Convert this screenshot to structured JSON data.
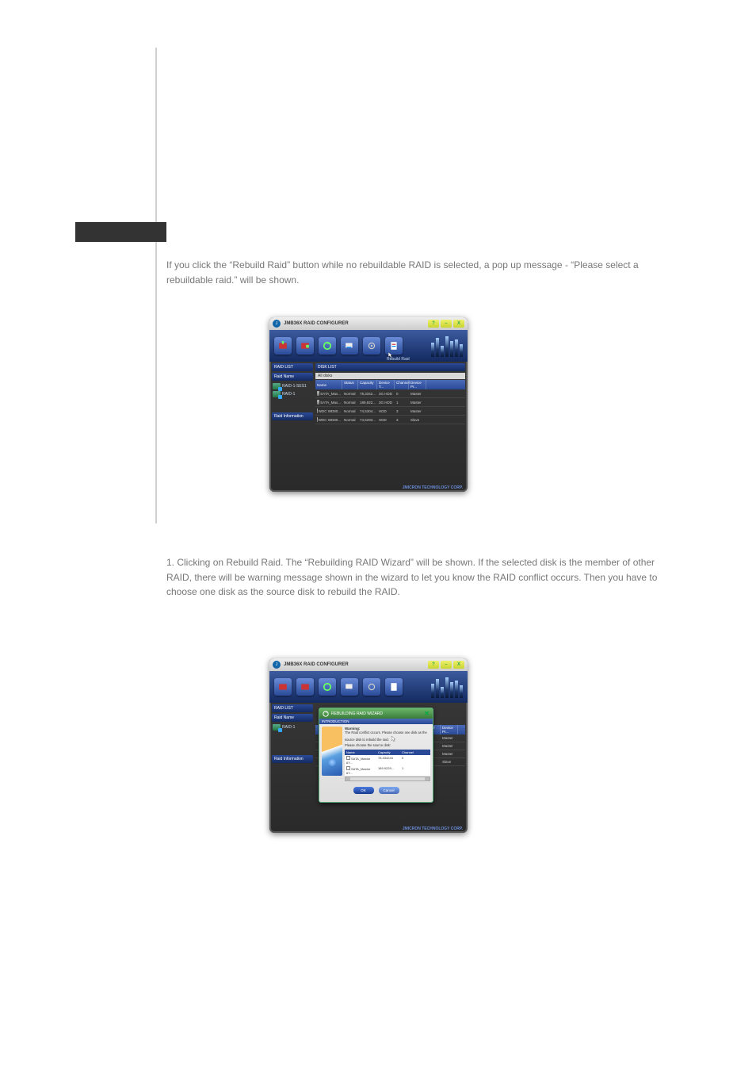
{
  "para1": "If you click the “Rebuild Raid” button while no rebuildable RAID is selected, a pop up message - “Please select a rebuildable raid.” will be shown.",
  "para2": "1. Clicking on Rebuild Raid. The “Rebuilding RAID Wizard” will be shown. If the selected disk is the member of other RAID, there will be warning message shown in the wizard to let you know the RAID conflict occurs. Then you have to choose one disk as the source disk to rebuild the RAID.",
  "app": {
    "title": "JMB36X RAID CONFIGURER",
    "rebuild_label": "Rebuild Raid",
    "footer": "JMICRON TECHNOLOGY CORP.",
    "titlebar_buttons": {
      "help": "?",
      "min": "–",
      "close": "X"
    }
  },
  "left": {
    "raid_list_hdr": "RAID LIST",
    "raid_name_hdr": "Raid Name",
    "raid_info_hdr": "Raid Information",
    "items1": [
      "RAID-1-SES1",
      "RAID-1"
    ],
    "items2": [
      "RAID-1"
    ]
  },
  "right": {
    "disk_list_hdr": "DISK LIST",
    "all_disks": "All disks",
    "cols": [
      "Name",
      "Status",
      "Capacity",
      "Device T...",
      "Channel",
      "Device Pr..."
    ],
    "rows1": [
      [
        "SATA_Max...",
        "Normal",
        "78,3342...",
        "3G HDD",
        "0",
        "Master"
      ],
      [
        "SATA_Max...",
        "Normal",
        "189,922...",
        "3G HDD",
        "1",
        "Master"
      ],
      [
        "WDC WD80...",
        "Normal",
        "74,5304...",
        "HDD",
        "3",
        "Master"
      ],
      [
        "WDC WD80...",
        "Normal",
        "74,5293...",
        "HDD",
        "3",
        "Slave"
      ]
    ],
    "rows2_right": [
      [
        "Master"
      ],
      [
        "Master"
      ],
      [
        "Master"
      ],
      [
        "Slave"
      ]
    ],
    "rows2_right_hdr": [
      "nnel",
      "Device Pr..."
    ]
  },
  "wizard": {
    "title": "REBUILDING RAID WIZARD",
    "intro": "INTRODUCTION",
    "warning_label": "Warning:",
    "warning_text": "The Raid conflict occurs. Please choose one disk as the source disk to rebuild the raid.",
    "choose": "Please choose the source disk:",
    "cols": [
      "Name",
      "Capacity",
      "Channel"
    ],
    "mrows": [
      [
        "SATA_Maxtor 6Y...",
        "78.334244",
        "0"
      ],
      [
        "SATA_Maxtor 6Y...",
        "189.9229...",
        "1"
      ]
    ],
    "ok": "OK",
    "cancel": "Cancel"
  }
}
